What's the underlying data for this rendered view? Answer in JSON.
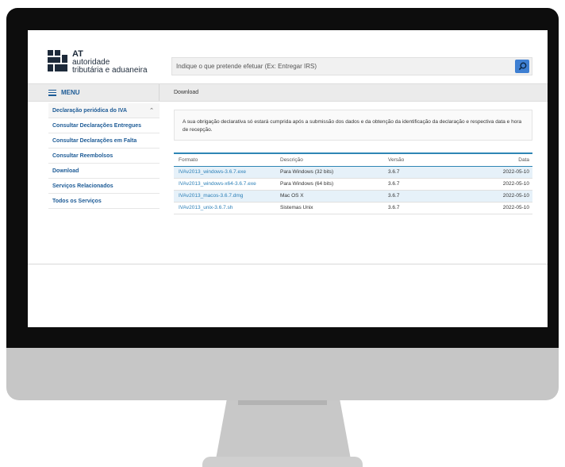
{
  "brand": {
    "short": "AT",
    "line1": "autoridade",
    "line2": "tributária e aduaneira"
  },
  "search": {
    "placeholder": "Indique o que pretende efetuar (Ex: Entregar IRS)",
    "icon": "search-icon",
    "button_color": "#3e7fd2"
  },
  "menu": {
    "label": "MENU",
    "icon": "hamburger-icon"
  },
  "breadcrumb": "Download",
  "sidebar": {
    "items": [
      {
        "label": "Declaração periódica do IVA"
      },
      {
        "label": "Consultar Declarações Entregues"
      },
      {
        "label": "Consultar Declarações em Falta"
      },
      {
        "label": "Consultar Reembolsos"
      },
      {
        "label": "Download"
      },
      {
        "label": "Serviços Relacionados"
      },
      {
        "label": "Todos os Serviços"
      }
    ],
    "expand_icon": "chevron-up-icon"
  },
  "notice": "A sua obrigação declarativa só estará cumprida após a submissão dos dados e da obtenção da identificação da declaração e respectiva data e hora de recepção.",
  "table": {
    "headers": [
      "Formato",
      "Descrição",
      "Versão",
      "Data"
    ],
    "rows": [
      {
        "formato": "IVAv2013_windows-3.6.7.exe",
        "descricao": "Para Windows (32 bits)",
        "versao": "3.6.7",
        "data": "2022-05-10"
      },
      {
        "formato": "IVAv2013_windows-x64-3.6.7.exe",
        "descricao": "Para Windows (64 bits)",
        "versao": "3.6.7",
        "data": "2022-05-10"
      },
      {
        "formato": "IVAv2013_macos-3.6.7.dmg",
        "descricao": "Mac OS X",
        "versao": "3.6.7",
        "data": "2022-05-10"
      },
      {
        "formato": "IVAv2013_unix-3.6.7.sh",
        "descricao": "Sistemas Unix",
        "versao": "3.6.7",
        "data": "2022-05-10"
      }
    ]
  },
  "colors": {
    "link": "#2b7fb7",
    "nav": "#1d5b96",
    "table_accent": "#2e86b5",
    "row_highlight": "#e6f1f9"
  }
}
